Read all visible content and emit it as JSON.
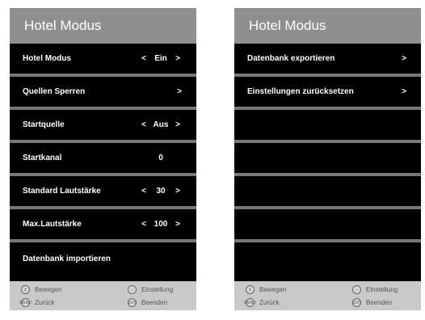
{
  "left_panel": {
    "title": "Hotel Modus",
    "rows": [
      {
        "label": "Hotel Modus",
        "left_arrow": "<",
        "value": "Ein",
        "right_arrow": ">"
      },
      {
        "label": "Quellen Sperren",
        "chevron": ">"
      },
      {
        "label": "Startquelle",
        "left_arrow": "<",
        "value": "Aus",
        "right_arrow": ">"
      },
      {
        "label": "Startkanal",
        "value": "0"
      },
      {
        "label": "Standard Lautstärke",
        "left_arrow": "<",
        "value": "30",
        "right_arrow": ">"
      },
      {
        "label": "Max.Lautstärke",
        "left_arrow": "<",
        "value": "100",
        "right_arrow": ">"
      },
      {
        "label": "Datenbank importieren"
      }
    ],
    "footer": {
      "move": {
        "icon": "up-down-icon",
        "label": "Bewegen"
      },
      "setting": {
        "icon": "left-right-icon",
        "label": "Einstellung"
      },
      "back": {
        "icon": "menu-button-icon",
        "label": "Zurück"
      },
      "exit": {
        "icon": "exit-button-icon",
        "label": "Beenden"
      }
    }
  },
  "right_panel": {
    "title": "Hotel Modus",
    "rows": [
      {
        "label": "Datenbank exportieren",
        "chevron": ">"
      },
      {
        "label": "Einstellungen zurücksetzen",
        "chevron": ">"
      }
    ],
    "footer": {
      "move": {
        "icon": "up-down-icon",
        "label": "Bewegen"
      },
      "setting": {
        "icon": "left-right-icon",
        "label": "Einstellung"
      },
      "back": {
        "icon": "menu-button-icon",
        "label": "Zurück"
      },
      "exit": {
        "icon": "exit-button-icon",
        "label": "Beenden"
      }
    }
  }
}
